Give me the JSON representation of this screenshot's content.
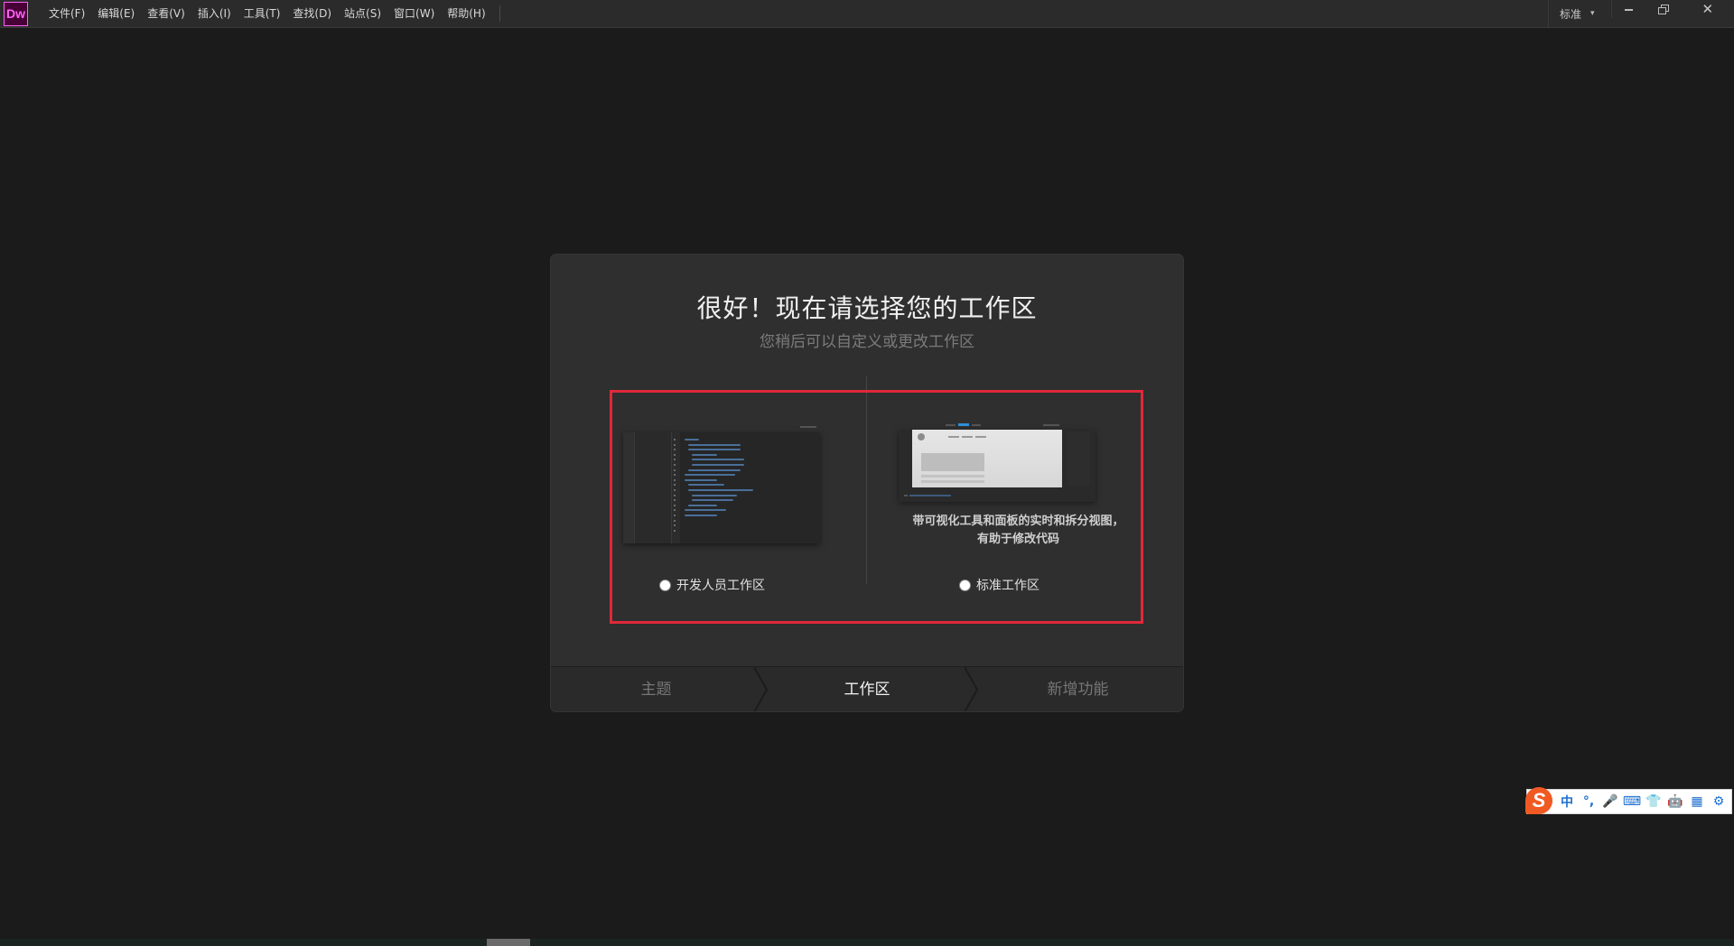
{
  "app": {
    "logo": "Dw",
    "menu": [
      "文件(F)",
      "编辑(E)",
      "查看(V)",
      "插入(I)",
      "工具(T)",
      "查找(D)",
      "站点(S)",
      "窗口(W)",
      "帮助(H)"
    ],
    "workspace_switcher": "标准",
    "window_controls": {
      "close_glyph": "✕"
    }
  },
  "dialog": {
    "title": "很好！现在请选择您的工作区",
    "subtitle": "您稍后可以自定义或更改工作区",
    "options": [
      {
        "label": "开发人员工作区",
        "description": ""
      },
      {
        "label": "标准工作区",
        "description": "带可视化工具和面板的实时和拆分视图，有助于修改代码"
      }
    ],
    "steps": [
      {
        "label": "主题",
        "active": false
      },
      {
        "label": "工作区",
        "active": true
      },
      {
        "label": "新增功能",
        "active": false
      }
    ]
  },
  "ime": {
    "logo": "S",
    "items": [
      "中",
      "°,",
      "🎤",
      "⌨",
      "👕",
      "🤖",
      "▦",
      "⚙"
    ],
    "logo_color": "#f05a22",
    "icon_color": "#1e6fd0"
  },
  "colors": {
    "highlight": "#e0283a",
    "brand": "#ff61f6",
    "code_accent": "#4a6f99",
    "active_tab": "#2f8fd8"
  }
}
